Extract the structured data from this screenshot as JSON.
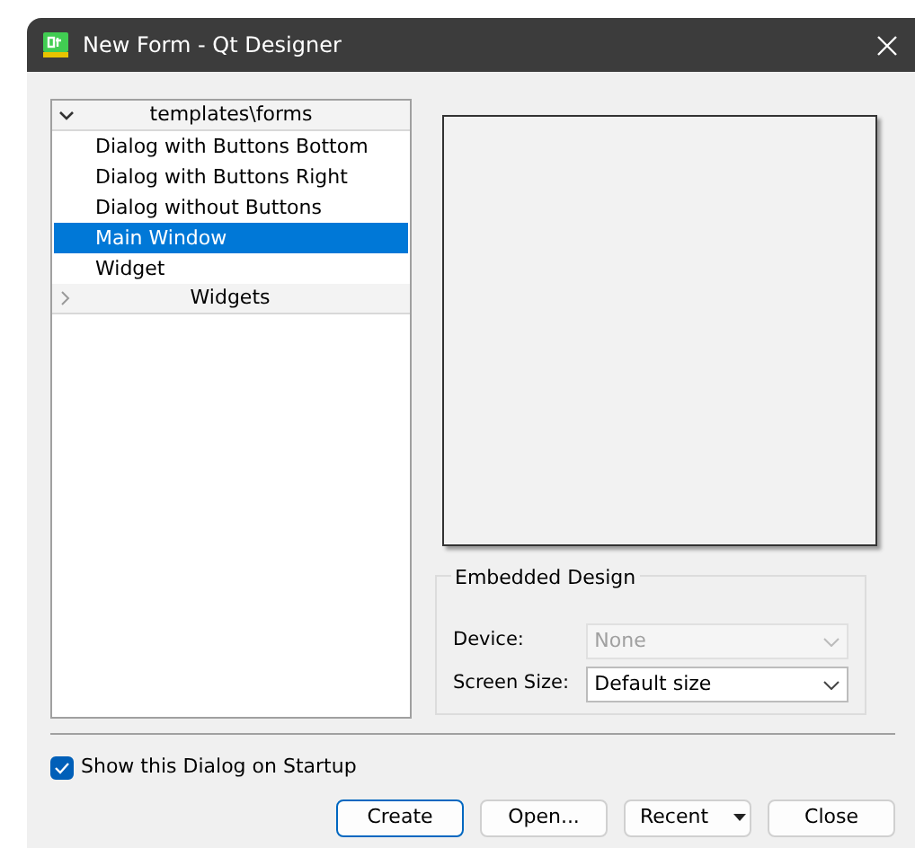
{
  "window": {
    "title": "New Form - Qt Designer"
  },
  "tree": {
    "groups": [
      {
        "label": "templates\\forms",
        "expanded": true,
        "children": [
          {
            "label": "Dialog with Buttons Bottom",
            "selected": false
          },
          {
            "label": "Dialog with Buttons Right",
            "selected": false
          },
          {
            "label": "Dialog without Buttons",
            "selected": false
          },
          {
            "label": "Main Window",
            "selected": true
          },
          {
            "label": "Widget",
            "selected": false
          }
        ]
      },
      {
        "label": "Widgets",
        "expanded": false
      }
    ]
  },
  "embedded_design": {
    "title": "Embedded Design",
    "fields": [
      {
        "label": "Device:",
        "value": "None",
        "disabled": true
      },
      {
        "label": "Screen Size:",
        "value": "Default size",
        "disabled": false
      }
    ]
  },
  "show_on_startup": {
    "label": "Show this Dialog on Startup",
    "checked": true
  },
  "buttons": [
    {
      "label": "Create",
      "kind": "default"
    },
    {
      "label": "Open...",
      "kind": "plain"
    },
    {
      "label": "Recent",
      "kind": "menu"
    },
    {
      "label": "Close",
      "kind": "plain"
    }
  ]
}
